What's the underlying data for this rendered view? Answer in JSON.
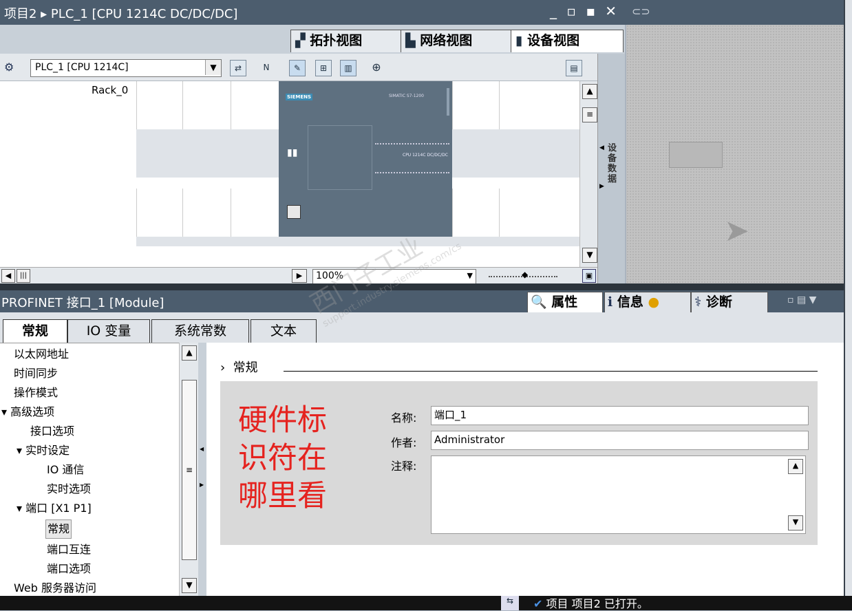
{
  "title_bar": {
    "text": "项目2 ▸ PLC_1 [CPU 1214C DC/DC/DC]",
    "controls": "_ ▫ ▪ ✕"
  },
  "view_tabs": [
    {
      "label": "拓扑视图",
      "icon": "topology-icon"
    },
    {
      "label": "网络视图",
      "icon": "network-icon"
    },
    {
      "label": "设备视图",
      "icon": "device-icon",
      "active": true
    }
  ],
  "toolbar": {
    "device_select": "PLC_1 [CPU 1214C]"
  },
  "canvas": {
    "rack_label": "Rack_0",
    "zoom": "100%",
    "side_tab_label": "设备数据"
  },
  "cpu": {
    "brand": "SIEMENS",
    "series": "SIMATIC S7-1200",
    "model": "CPU 1214C DC/DC/DC"
  },
  "inspector": {
    "title": "PROFINET 接口_1 [Module]",
    "tabs": [
      {
        "label": "属性",
        "icon": "properties-icon",
        "active": true
      },
      {
        "label": "信息",
        "icon": "info-icon"
      },
      {
        "label": "诊断",
        "icon": "diagnostics-icon"
      }
    ],
    "subtabs": [
      "常规",
      "IO 变量",
      "系统常数",
      "文本"
    ],
    "nav": [
      {
        "label": "以太网地址",
        "level": 0
      },
      {
        "label": "时间同步",
        "level": 0
      },
      {
        "label": "操作模式",
        "level": 0
      },
      {
        "label": "▾ 高级选项",
        "level": 0
      },
      {
        "label": "接口选项",
        "level": 1
      },
      {
        "label": "▾ 实时设定",
        "level": 1
      },
      {
        "label": "IO 通信",
        "level": 2
      },
      {
        "label": "实时选项",
        "level": 2
      },
      {
        "label": "▾ 端口 [X1 P1]",
        "level": 1
      },
      {
        "label": "常规",
        "level": 2,
        "selected": true
      },
      {
        "label": "端口互连",
        "level": 2
      },
      {
        "label": "端口选项",
        "level": 2
      },
      {
        "label": "Web 服务器访问",
        "level": 0
      }
    ],
    "section_title": "常规",
    "annotation": "硬件标识符在哪里看",
    "fields": {
      "name_label": "名称:",
      "name_value": "端口_1",
      "author_label": "作者:",
      "author_value": "Administrator",
      "comment_label": "注释:",
      "comment_value": ""
    }
  },
  "status_bar": {
    "text": "项目 项目2 已打开。"
  },
  "watermark": {
    "line1": "西门子工业",
    "line2": "support.industry.siemens.com/cs"
  }
}
